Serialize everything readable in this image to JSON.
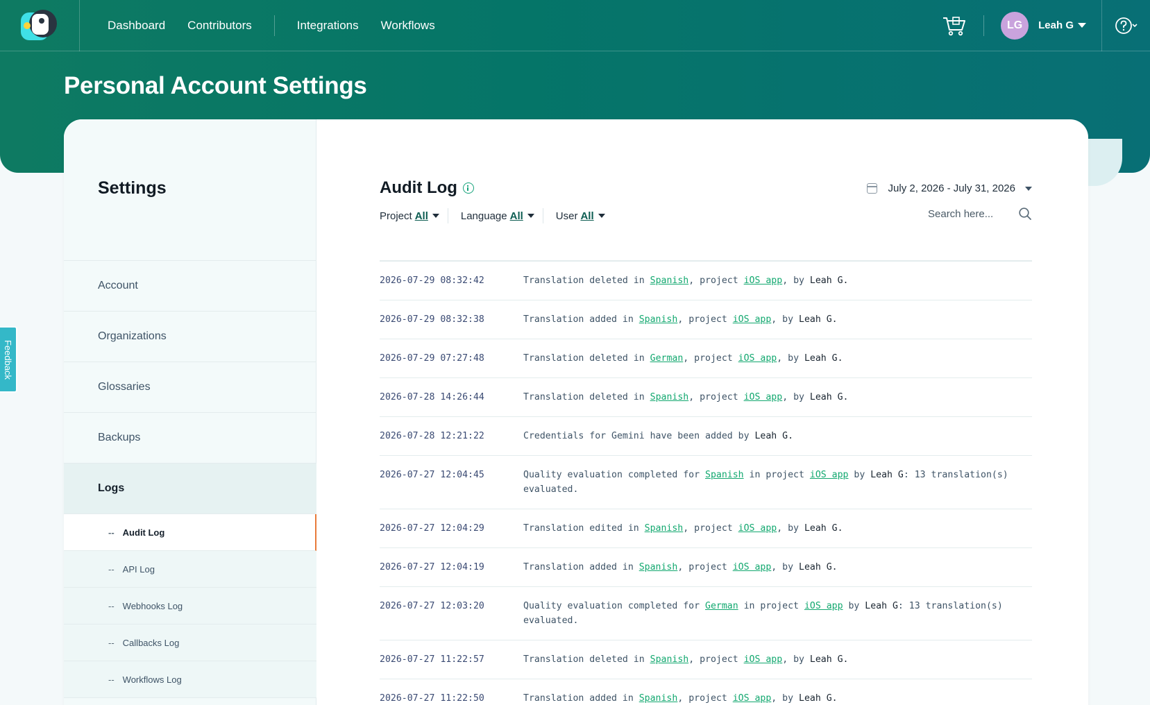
{
  "nav": {
    "items": [
      "Dashboard",
      "Contributors",
      "Integrations",
      "Workflows"
    ]
  },
  "user": {
    "initials": "LG",
    "name": "Leah G"
  },
  "page_title": "Personal Account Settings",
  "sidebar": {
    "title": "Settings",
    "items": [
      "Account",
      "Organizations",
      "Glossaries",
      "Backups",
      "Logs"
    ],
    "sub_items": [
      "Audit Log",
      "API Log",
      "Webhooks Log",
      "Callbacks Log",
      "Workflows Log"
    ],
    "sub_prefix": "--"
  },
  "audit": {
    "title": "Audit Log",
    "date_range": "July 2, 2026 - July 31, 2026",
    "filters": [
      {
        "label": "Project",
        "value": "All"
      },
      {
        "label": "Language",
        "value": "All"
      },
      {
        "label": "User",
        "value": "All"
      }
    ],
    "search_placeholder": "Search here..."
  },
  "logs": [
    {
      "time": "2026-07-29 08:32:42",
      "parts": [
        [
          "t",
          "Translation deleted in "
        ],
        [
          "l",
          "Spanish"
        ],
        [
          "t",
          ", project "
        ],
        [
          "l",
          "iOS app"
        ],
        [
          "t",
          ", by "
        ],
        [
          "u",
          "Leah G."
        ]
      ]
    },
    {
      "time": "2026-07-29 08:32:38",
      "parts": [
        [
          "t",
          "Translation added in "
        ],
        [
          "l",
          "Spanish"
        ],
        [
          "t",
          ", project "
        ],
        [
          "l",
          "iOS app"
        ],
        [
          "t",
          ", by "
        ],
        [
          "u",
          "Leah G."
        ]
      ]
    },
    {
      "time": "2026-07-29 07:27:48",
      "parts": [
        [
          "t",
          "Translation deleted in "
        ],
        [
          "l",
          "German"
        ],
        [
          "t",
          ", project "
        ],
        [
          "l",
          "iOS app"
        ],
        [
          "t",
          ", by "
        ],
        [
          "u",
          "Leah G."
        ]
      ]
    },
    {
      "time": "2026-07-28 14:26:44",
      "parts": [
        [
          "t",
          "Translation deleted in "
        ],
        [
          "l",
          "Spanish"
        ],
        [
          "t",
          ", project "
        ],
        [
          "l",
          "iOS app"
        ],
        [
          "t",
          ", by "
        ],
        [
          "u",
          "Leah G."
        ]
      ]
    },
    {
      "time": "2026-07-28 12:21:22",
      "parts": [
        [
          "t",
          "Credentials for Gemini have been added by "
        ],
        [
          "u",
          "Leah G."
        ]
      ]
    },
    {
      "time": "2026-07-27 12:04:45",
      "parts": [
        [
          "t",
          "Quality evaluation completed for "
        ],
        [
          "l",
          "Spanish"
        ],
        [
          "t",
          " in project "
        ],
        [
          "l",
          "iOS app"
        ],
        [
          "t",
          " by "
        ],
        [
          "u",
          "Leah G"
        ],
        [
          "t",
          ": 13 translation(s) evaluated."
        ]
      ]
    },
    {
      "time": "2026-07-27 12:04:29",
      "parts": [
        [
          "t",
          "Translation edited in "
        ],
        [
          "l",
          "Spanish"
        ],
        [
          "t",
          ", project "
        ],
        [
          "l",
          "iOS app"
        ],
        [
          "t",
          ", by "
        ],
        [
          "u",
          "Leah G."
        ]
      ]
    },
    {
      "time": "2026-07-27 12:04:19",
      "parts": [
        [
          "t",
          "Translation added in "
        ],
        [
          "l",
          "Spanish"
        ],
        [
          "t",
          ", project "
        ],
        [
          "l",
          "iOS app"
        ],
        [
          "t",
          ", by "
        ],
        [
          "u",
          "Leah G."
        ]
      ]
    },
    {
      "time": "2026-07-27 12:03:20",
      "parts": [
        [
          "t",
          "Quality evaluation completed for "
        ],
        [
          "l",
          "German"
        ],
        [
          "t",
          " in project "
        ],
        [
          "l",
          "iOS app"
        ],
        [
          "t",
          " by "
        ],
        [
          "u",
          "Leah G"
        ],
        [
          "t",
          ": 13 translation(s) evaluated."
        ]
      ]
    },
    {
      "time": "2026-07-27 11:22:57",
      "parts": [
        [
          "t",
          "Translation deleted in "
        ],
        [
          "l",
          "Spanish"
        ],
        [
          "t",
          ", project "
        ],
        [
          "l",
          "iOS app"
        ],
        [
          "t",
          ", by "
        ],
        [
          "u",
          "Leah G."
        ]
      ]
    },
    {
      "time": "2026-07-27 11:22:50",
      "parts": [
        [
          "t",
          "Translation added in "
        ],
        [
          "l",
          "Spanish"
        ],
        [
          "t",
          ", project "
        ],
        [
          "l",
          "iOS app"
        ],
        [
          "t",
          ", by "
        ],
        [
          "u",
          "Leah G."
        ]
      ]
    }
  ],
  "feedback_label": "Feedback",
  "colors": {
    "brand": "#057568",
    "accent_link": "#12a86f",
    "active_marker": "#e87a3a"
  }
}
